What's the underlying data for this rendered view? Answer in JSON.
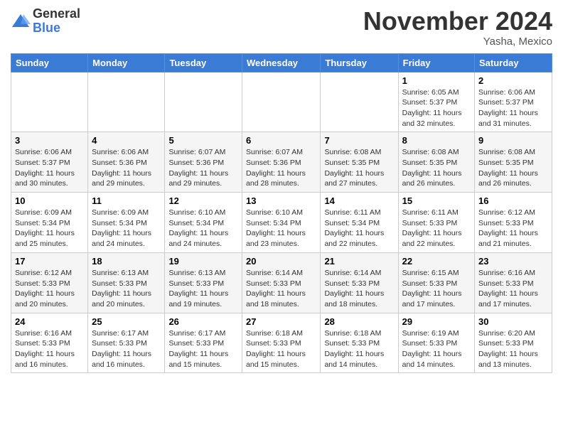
{
  "logo": {
    "general": "General",
    "blue": "Blue"
  },
  "header": {
    "month": "November 2024",
    "location": "Yasha, Mexico"
  },
  "weekdays": [
    "Sunday",
    "Monday",
    "Tuesday",
    "Wednesday",
    "Thursday",
    "Friday",
    "Saturday"
  ],
  "weeks": [
    [
      {
        "day": "",
        "info": ""
      },
      {
        "day": "",
        "info": ""
      },
      {
        "day": "",
        "info": ""
      },
      {
        "day": "",
        "info": ""
      },
      {
        "day": "",
        "info": ""
      },
      {
        "day": "1",
        "info": "Sunrise: 6:05 AM\nSunset: 5:37 PM\nDaylight: 11 hours and 32 minutes."
      },
      {
        "day": "2",
        "info": "Sunrise: 6:06 AM\nSunset: 5:37 PM\nDaylight: 11 hours and 31 minutes."
      }
    ],
    [
      {
        "day": "3",
        "info": "Sunrise: 6:06 AM\nSunset: 5:37 PM\nDaylight: 11 hours and 30 minutes."
      },
      {
        "day": "4",
        "info": "Sunrise: 6:06 AM\nSunset: 5:36 PM\nDaylight: 11 hours and 29 minutes."
      },
      {
        "day": "5",
        "info": "Sunrise: 6:07 AM\nSunset: 5:36 PM\nDaylight: 11 hours and 29 minutes."
      },
      {
        "day": "6",
        "info": "Sunrise: 6:07 AM\nSunset: 5:36 PM\nDaylight: 11 hours and 28 minutes."
      },
      {
        "day": "7",
        "info": "Sunrise: 6:08 AM\nSunset: 5:35 PM\nDaylight: 11 hours and 27 minutes."
      },
      {
        "day": "8",
        "info": "Sunrise: 6:08 AM\nSunset: 5:35 PM\nDaylight: 11 hours and 26 minutes."
      },
      {
        "day": "9",
        "info": "Sunrise: 6:08 AM\nSunset: 5:35 PM\nDaylight: 11 hours and 26 minutes."
      }
    ],
    [
      {
        "day": "10",
        "info": "Sunrise: 6:09 AM\nSunset: 5:34 PM\nDaylight: 11 hours and 25 minutes."
      },
      {
        "day": "11",
        "info": "Sunrise: 6:09 AM\nSunset: 5:34 PM\nDaylight: 11 hours and 24 minutes."
      },
      {
        "day": "12",
        "info": "Sunrise: 6:10 AM\nSunset: 5:34 PM\nDaylight: 11 hours and 24 minutes."
      },
      {
        "day": "13",
        "info": "Sunrise: 6:10 AM\nSunset: 5:34 PM\nDaylight: 11 hours and 23 minutes."
      },
      {
        "day": "14",
        "info": "Sunrise: 6:11 AM\nSunset: 5:34 PM\nDaylight: 11 hours and 22 minutes."
      },
      {
        "day": "15",
        "info": "Sunrise: 6:11 AM\nSunset: 5:33 PM\nDaylight: 11 hours and 22 minutes."
      },
      {
        "day": "16",
        "info": "Sunrise: 6:12 AM\nSunset: 5:33 PM\nDaylight: 11 hours and 21 minutes."
      }
    ],
    [
      {
        "day": "17",
        "info": "Sunrise: 6:12 AM\nSunset: 5:33 PM\nDaylight: 11 hours and 20 minutes."
      },
      {
        "day": "18",
        "info": "Sunrise: 6:13 AM\nSunset: 5:33 PM\nDaylight: 11 hours and 20 minutes."
      },
      {
        "day": "19",
        "info": "Sunrise: 6:13 AM\nSunset: 5:33 PM\nDaylight: 11 hours and 19 minutes."
      },
      {
        "day": "20",
        "info": "Sunrise: 6:14 AM\nSunset: 5:33 PM\nDaylight: 11 hours and 18 minutes."
      },
      {
        "day": "21",
        "info": "Sunrise: 6:14 AM\nSunset: 5:33 PM\nDaylight: 11 hours and 18 minutes."
      },
      {
        "day": "22",
        "info": "Sunrise: 6:15 AM\nSunset: 5:33 PM\nDaylight: 11 hours and 17 minutes."
      },
      {
        "day": "23",
        "info": "Sunrise: 6:16 AM\nSunset: 5:33 PM\nDaylight: 11 hours and 17 minutes."
      }
    ],
    [
      {
        "day": "24",
        "info": "Sunrise: 6:16 AM\nSunset: 5:33 PM\nDaylight: 11 hours and 16 minutes."
      },
      {
        "day": "25",
        "info": "Sunrise: 6:17 AM\nSunset: 5:33 PM\nDaylight: 11 hours and 16 minutes."
      },
      {
        "day": "26",
        "info": "Sunrise: 6:17 AM\nSunset: 5:33 PM\nDaylight: 11 hours and 15 minutes."
      },
      {
        "day": "27",
        "info": "Sunrise: 6:18 AM\nSunset: 5:33 PM\nDaylight: 11 hours and 15 minutes."
      },
      {
        "day": "28",
        "info": "Sunrise: 6:18 AM\nSunset: 5:33 PM\nDaylight: 11 hours and 14 minutes."
      },
      {
        "day": "29",
        "info": "Sunrise: 6:19 AM\nSunset: 5:33 PM\nDaylight: 11 hours and 14 minutes."
      },
      {
        "day": "30",
        "info": "Sunrise: 6:20 AM\nSunset: 5:33 PM\nDaylight: 11 hours and 13 minutes."
      }
    ]
  ]
}
